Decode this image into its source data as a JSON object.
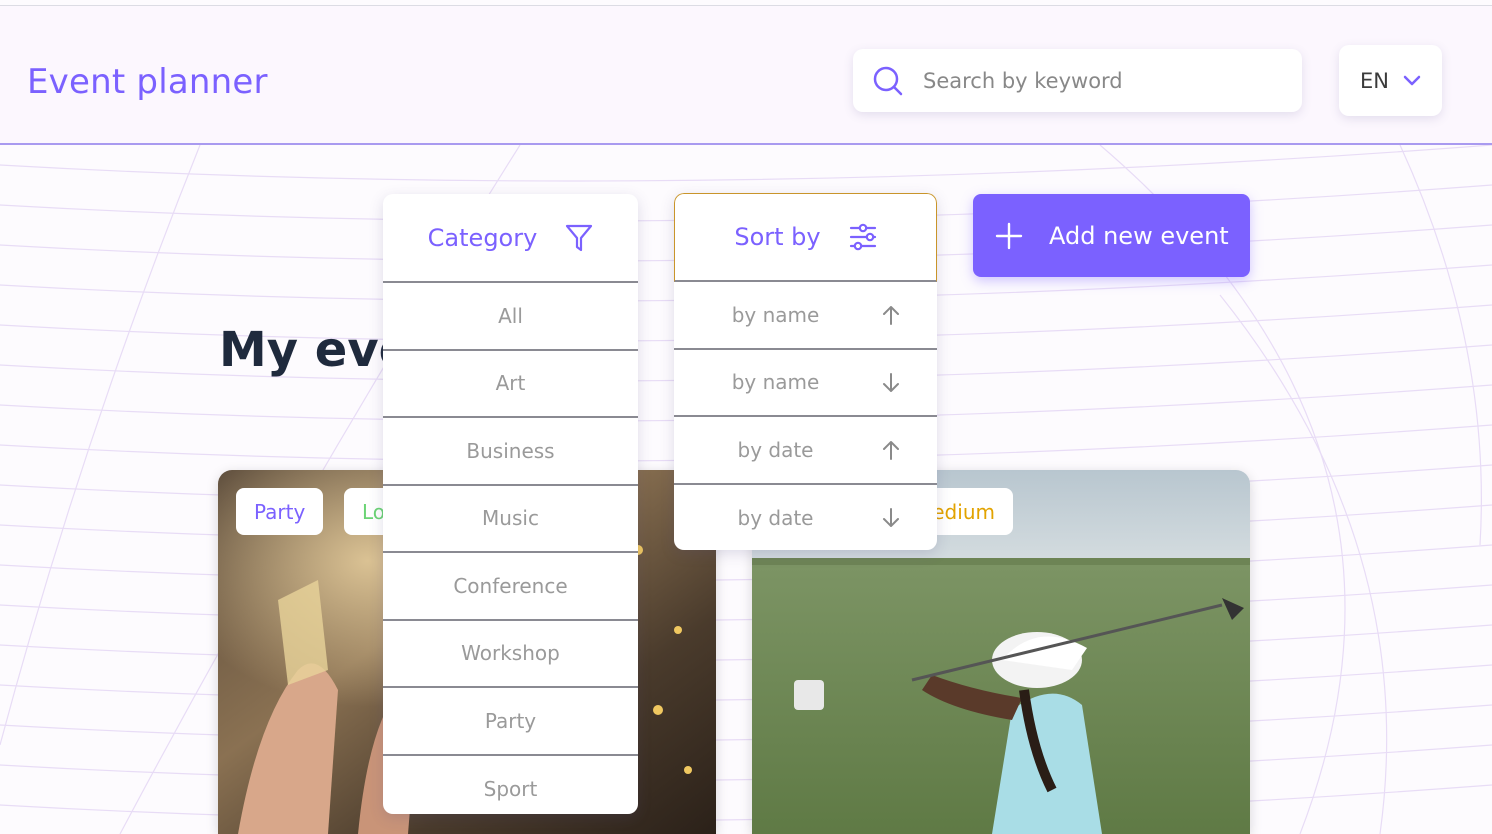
{
  "header": {
    "logo": "Event planner",
    "search_placeholder": "Search by keyword",
    "language": "EN"
  },
  "main": {
    "title": "My events",
    "add_button_label": "Add new event"
  },
  "category_filter": {
    "label": "Category",
    "options": [
      "All",
      "Art",
      "Business",
      "Music",
      "Conference",
      "Workshop",
      "Party",
      "Sport"
    ]
  },
  "sort": {
    "label": "Sort by",
    "options": [
      {
        "label": "by name",
        "direction": "ascending"
      },
      {
        "label": "by name",
        "direction": "descending"
      },
      {
        "label": "by date",
        "direction": "ascending"
      },
      {
        "label": "by date",
        "direction": "descending"
      }
    ]
  },
  "cards": [
    {
      "tags": [
        {
          "label": "Party",
          "color": "#7b61ff"
        },
        {
          "label": "Low",
          "color": "#6bd475"
        }
      ]
    },
    {
      "tags": [
        {
          "label": "Medium",
          "color": "#e2a300"
        }
      ]
    }
  ],
  "colors": {
    "accent": "#7b61ff",
    "title": "#1f2a3d",
    "low": "#6bd475",
    "medium": "#e2a300"
  }
}
